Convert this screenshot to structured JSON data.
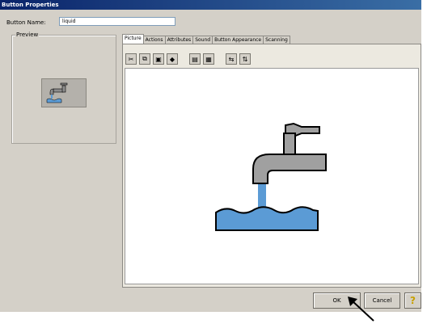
{
  "window": {
    "title": "Button Properties"
  },
  "button_name": {
    "label": "Button Name:",
    "value": "liquid"
  },
  "preview": {
    "label": "Preview"
  },
  "tabs": [
    {
      "label": "Picture",
      "active": true
    },
    {
      "label": "Actions"
    },
    {
      "label": "Attributes"
    },
    {
      "label": "Sound"
    },
    {
      "label": "Button Appearance"
    },
    {
      "label": "Scanning"
    }
  ],
  "toolbar": [
    "scissors-icon",
    "copy-icon",
    "paste-icon",
    "eraser-icon",
    "insert-picture-icon",
    "fit-picture-icon",
    "flip-horizontal-icon",
    "flip-vertical-icon"
  ],
  "picture": {
    "name": "water faucet",
    "pipe_color": "#a0a0a0",
    "water_color": "#5b9bd5"
  },
  "buttons": {
    "ok": "OK",
    "cancel": "Cancel",
    "help": "?"
  }
}
